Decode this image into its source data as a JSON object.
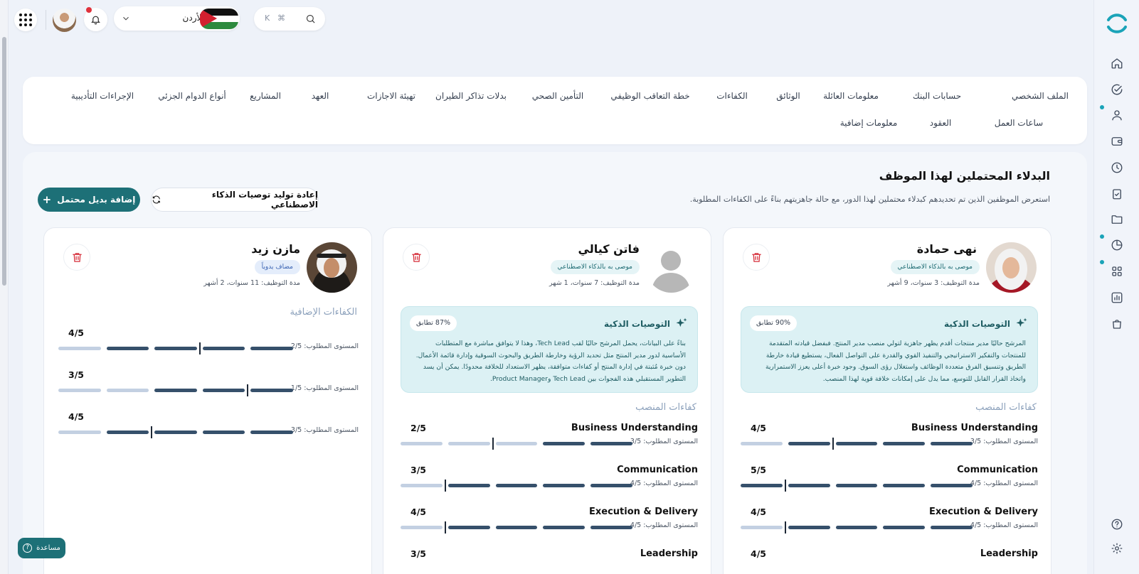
{
  "topbar": {
    "branch_label": "فرع الأردن",
    "search_keys": [
      "K",
      "⌘"
    ],
    "icons": [
      "apps-grid-icon",
      "avatar",
      "bell-icon",
      "chevron-down-icon",
      "jordan-flag",
      "search-icon"
    ]
  },
  "sidebar": {
    "icons": [
      "home-icon",
      "check-circle-icon",
      "user-icon",
      "wallet-icon",
      "clock-icon",
      "clipboard-check-icon",
      "folder-icon",
      "pie-chart-icon",
      "apps-icon",
      "bar-chart-icon",
      "bag-icon",
      "help-icon",
      "gear-icon"
    ]
  },
  "tabs": {
    "row1": [
      "الملف الشخصي",
      "حسابات البنك",
      "معلومات العائلة",
      "الوثائق",
      "الكفاءات",
      "خطة التعاقب الوظيفي",
      "التأمين الصحي",
      "بدلات تذاكر الطيران",
      "تهيئة الاجازات",
      "العهد",
      "المشاريع",
      "أنواع الدوام الجزئي",
      "الإجراءات التأديبية"
    ],
    "row2": [
      "ساعات العمل",
      "العقود",
      "معلومات إضافية"
    ]
  },
  "section": {
    "title": "البدلاء المحتملين لهذا الموظف",
    "subtitle": "استعرض الموظفين الذين تم تحديدهم كبدلاء محتملين لهذا الدور، مع حالة جاهزيتهم بناءً على الكفاءات المطلوبة.",
    "add_button": "إضافة بديل محتمل",
    "regen_button": "إعادة توليد توصيات الذكاء الاصطناعي"
  },
  "candidates": [
    {
      "name": "نهى حمادة",
      "badge": "موصى به بالذكاء الاصطناعي",
      "tenure": "مدة التوظيف: 3 سنوات، 9 أشهر",
      "ai_title": "التوصيات الذكية",
      "match": "90% تطابق",
      "ai_text": "المرشح حاليًا مدير منتجات أقدم يظهر جاهزية لتولي منصب مدير المنتج. فبفضل قيادته المتقدمة للمنتجات والتفكير الاستراتيجي والتنفيذ القوي والقدرة على التواصل الفعال، يستطيع قيادة خارطة الطريق وتنسيق الفرق متعددة الوظائف واستغلال رؤى السوق. وجود خبرة أعلى يعزز الاستمرارية واتخاذ القرار القابل للتوسع، مما يدل على إمكانات خلافة قوية لهذا المنصب.",
      "comp_head": "كفاءات المنصب",
      "competencies": [
        {
          "name": "Business Understanding",
          "score": "4/5",
          "required": "المستوى المطلوب: 3/5",
          "level": 4,
          "req": 3
        },
        {
          "name": "Communication",
          "score": "5/5",
          "required": "المستوى المطلوب: 4/5",
          "level": 5,
          "req": 4
        },
        {
          "name": "Execution & Delivery",
          "score": "4/5",
          "required": "المستوى المطلوب: 4/5",
          "level": 4,
          "req": 4
        },
        {
          "name": "Leadership",
          "score": "4/5"
        }
      ]
    },
    {
      "name": "فاتن كيالي",
      "badge": "موصى به بالذكاء الاصطناعي",
      "tenure": "مدة التوظيف: 7 سنوات، 1 شهر",
      "ai_title": "التوصيات الذكية",
      "match": "87% تطابق",
      "ai_text": "بناءً على البيانات، يحمل المرشح حاليًا لقب Tech Lead، وهذا لا يتوافق مباشرة مع المتطلبات الأساسية لدور مدير المنتج مثل تحديد الرؤية وخارطة الطريق والبحوث السوقية وإدارة قائمة الأعمال. دون خبرة مُثبتة في إدارة المنتج أو كفاءات متوافقة، يظهر الاستعداد للخلافة محدودًا. يمكن أن يسد التطوير المستقبلي هذه الفجوات بين Tech Lead وProduct Manager.",
      "comp_head": "كفاءات المنصب",
      "competencies": [
        {
          "name": "Business Understanding",
          "score": "2/5",
          "required": "المستوى المطلوب: 3/5",
          "level": 2,
          "req": 3
        },
        {
          "name": "Communication",
          "score": "3/5",
          "required": "المستوى المطلوب: 4/5",
          "level": 4,
          "req": 4
        },
        {
          "name": "Execution & Delivery",
          "score": "4/5",
          "required": "المستوى المطلوب: 4/5",
          "level": 4,
          "req": 4
        },
        {
          "name": "Leadership",
          "score": "3/5"
        }
      ]
    },
    {
      "name": "مازن زيد",
      "badge": "مضاف يدوياً",
      "tenure": "مدة التوظيف: 11 سنوات، 2 أشهر",
      "comp_head": "الكفاءات الإضافية",
      "competencies": [
        {
          "score": "4/5",
          "required": "المستوى المطلوب: 2/5",
          "level": 4,
          "req": 2
        },
        {
          "score": "3/5",
          "required": "المستوى المطلوب: 1/5",
          "level": 3,
          "req": 1
        },
        {
          "score": "4/5",
          "required": "المستوى المطلوب: 3/5",
          "level": 4,
          "req": 3
        }
      ]
    }
  ],
  "help_button": "مساعدة",
  "colors": {
    "accent": "#1d7077",
    "bar_on": "#36506b",
    "bar_off": "#c3d0e2",
    "delete": "#d62e3a"
  }
}
